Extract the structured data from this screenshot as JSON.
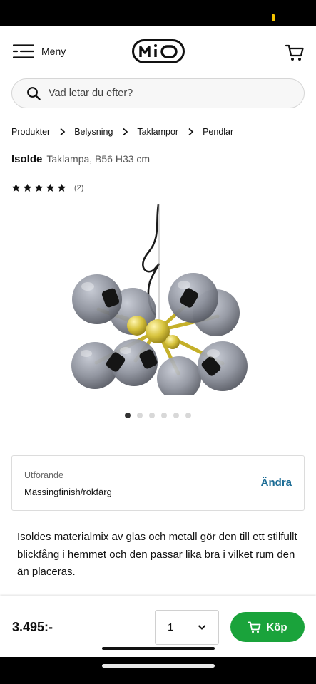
{
  "colors": {
    "accent_buy": "#1aa33b",
    "link": "#1b6c95",
    "status_indicator": "#f5c400"
  },
  "header": {
    "menu_label": "Meny",
    "logo_text": "MIO",
    "menu_icon": "hamburger-icon",
    "cart_icon": "cart-icon"
  },
  "search": {
    "placeholder": "Vad letar du efter?",
    "icon": "search-icon"
  },
  "breadcrumb": [
    "Produkter",
    "Belysning",
    "Taklampor",
    "Pendlar"
  ],
  "product": {
    "name": "Isolde",
    "subtitle": "Taklampa, B56 H33 cm",
    "rating": {
      "stars": 5,
      "max": 5,
      "count_text": "(2)"
    },
    "image_count": 6,
    "active_image": 1,
    "variant": {
      "label": "Utförande",
      "value": "Mässingfinish/rökfärg",
      "change_label": "Ändra"
    },
    "description": "Isoldes materialmix av glas och metall gör den till ett stilfullt blickfång i hemmet och den passar lika bra i vilket rum den än placeras."
  },
  "purchase": {
    "price": "3.495:-",
    "quantity": "1",
    "buy_label": "Köp",
    "buy_icon": "cart-icon"
  }
}
